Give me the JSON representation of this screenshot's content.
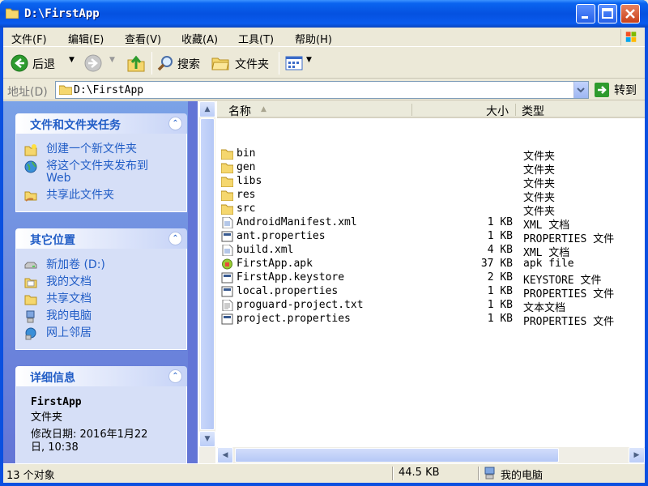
{
  "window": {
    "title": "D:\\FirstApp"
  },
  "menu": [
    "文件(F)",
    "编辑(E)",
    "查看(V)",
    "收藏(A)",
    "工具(T)",
    "帮助(H)"
  ],
  "toolbar": {
    "back": "后退",
    "search": "搜索",
    "folders": "文件夹"
  },
  "address": {
    "label": "地址(D)",
    "value": "D:\\FirstApp",
    "go": "转到"
  },
  "tasks": {
    "title": "文件和文件夹任务",
    "items": [
      {
        "label": "创建一个新文件夹",
        "icon": "new-folder-icon"
      },
      {
        "label": "将这个文件夹发布到",
        "label2": "Web",
        "icon": "publish-web-icon"
      },
      {
        "label": "共享此文件夹",
        "icon": "share-folder-icon"
      }
    ]
  },
  "places": {
    "title": "其它位置",
    "items": [
      {
        "label": "新加卷 (D:)",
        "icon": "drive-icon"
      },
      {
        "label": "我的文档",
        "icon": "my-documents-icon"
      },
      {
        "label": "共享文档",
        "icon": "shared-documents-icon"
      },
      {
        "label": "我的电脑",
        "icon": "my-computer-icon"
      },
      {
        "label": "网上邻居",
        "icon": "network-places-icon"
      }
    ]
  },
  "details": {
    "title": "详细信息",
    "name": "FirstApp",
    "kind": "文件夹",
    "modified_line1": "修改日期: 2016年1月22",
    "modified_line2": "日, 10:38"
  },
  "columns": {
    "name": "名称",
    "size": "大小",
    "type": "类型"
  },
  "files": [
    {
      "name": "bin",
      "size": "",
      "type": "文件夹",
      "icon": "folder-icon"
    },
    {
      "name": "gen",
      "size": "",
      "type": "文件夹",
      "icon": "folder-icon"
    },
    {
      "name": "libs",
      "size": "",
      "type": "文件夹",
      "icon": "folder-icon"
    },
    {
      "name": "res",
      "size": "",
      "type": "文件夹",
      "icon": "folder-icon"
    },
    {
      "name": "src",
      "size": "",
      "type": "文件夹",
      "icon": "folder-icon"
    },
    {
      "name": "AndroidManifest.xml",
      "size": "1 KB",
      "type": "XML 文档",
      "icon": "xml-file-icon"
    },
    {
      "name": "ant.properties",
      "size": "1 KB",
      "type": "PROPERTIES 文件",
      "icon": "generic-file-icon"
    },
    {
      "name": "build.xml",
      "size": "4 KB",
      "type": "XML 文档",
      "icon": "xml-file-icon"
    },
    {
      "name": "FirstApp.apk",
      "size": "37 KB",
      "type": "apk file",
      "icon": "apk-file-icon"
    },
    {
      "name": "FirstApp.keystore",
      "size": "2 KB",
      "type": "KEYSTORE 文件",
      "icon": "generic-file-icon"
    },
    {
      "name": "local.properties",
      "size": "1 KB",
      "type": "PROPERTIES 文件",
      "icon": "generic-file-icon"
    },
    {
      "name": "proguard-project.txt",
      "size": "1 KB",
      "type": "文本文档",
      "icon": "text-file-icon"
    },
    {
      "name": "project.properties",
      "size": "1 KB",
      "type": "PROPERTIES 文件",
      "icon": "generic-file-icon"
    }
  ],
  "status": {
    "count": "13 个对象",
    "size": "44.5 KB",
    "location": "我的电脑"
  }
}
